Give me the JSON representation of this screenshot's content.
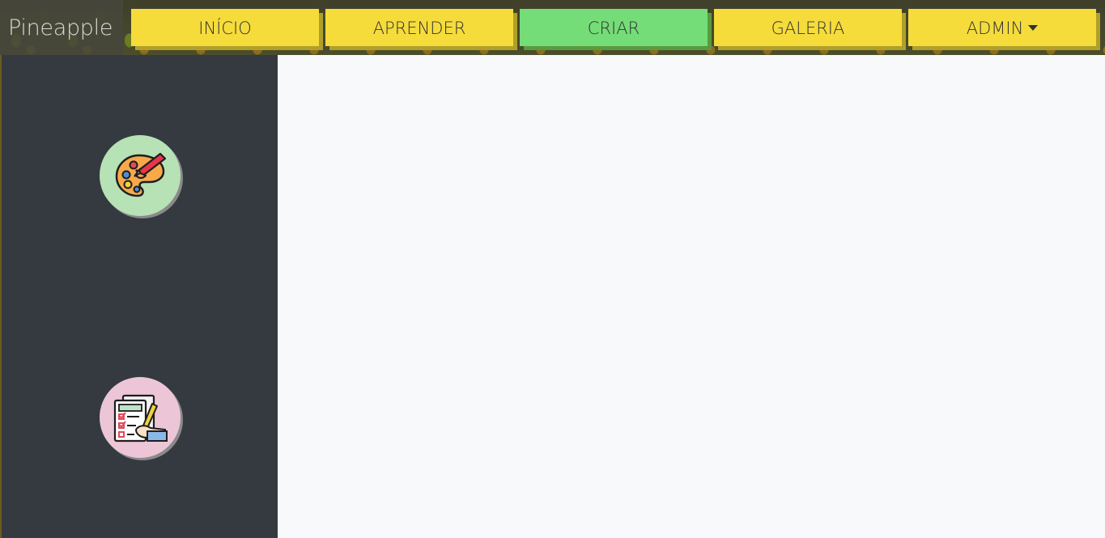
{
  "navbar": {
    "brand": "Pineapple",
    "items": [
      {
        "label": "INÍCIO",
        "active": false
      },
      {
        "label": "APRENDER",
        "active": false
      },
      {
        "label": "CRIAR",
        "active": true
      },
      {
        "label": "GALERIA",
        "active": false
      },
      {
        "label": "ADMIN",
        "active": false,
        "dropdown": true
      }
    ]
  },
  "sidebar": {
    "buttons": [
      {
        "icon": "paint-palette-icon",
        "color": "#b6e2b6"
      },
      {
        "icon": "checklist-icon",
        "color": "#ecc6d6"
      }
    ]
  },
  "colors": {
    "nav_button": "#f5dc3b",
    "nav_button_active": "#74dd78",
    "sidebar_bg": "#343a40",
    "main_bg": "#f8f9fb"
  }
}
